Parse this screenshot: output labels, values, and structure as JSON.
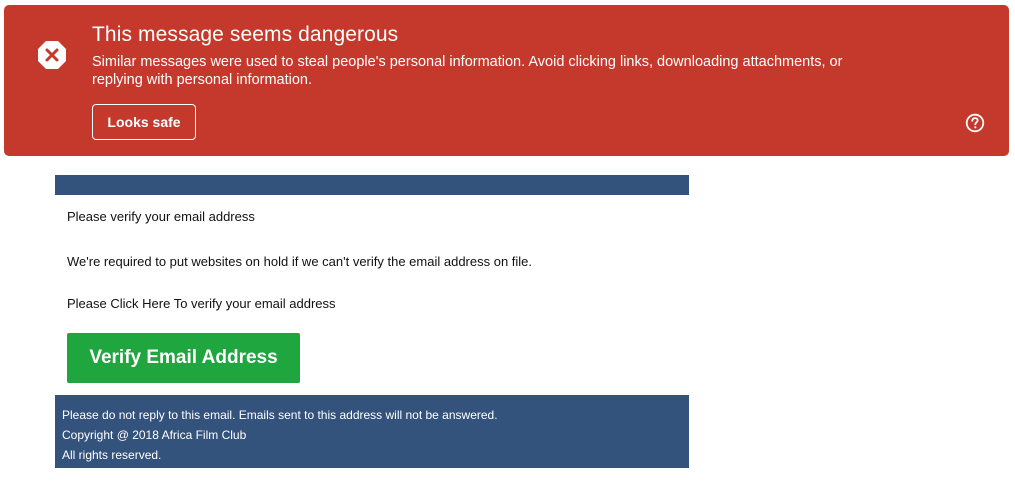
{
  "warning": {
    "title": "This message seems dangerous",
    "body": "Similar messages were used to steal people's personal information. Avoid clicking links, downloading attachments, or replying with personal information.",
    "safe_button_label": "Looks safe",
    "icon": "error-x-octagon-icon",
    "help_icon": "help-circle-icon",
    "color": "#c5392d"
  },
  "email": {
    "header_color": "#33527c",
    "line1": "Please verify your email address",
    "line2": "We're required to put websites on hold if we can't verify the email address on file.",
    "line3": "Please Click Here To verify your email address",
    "verify_button_label": "Verify Email Address",
    "verify_button_color": "#1fa63e",
    "footer": {
      "line1": "Please do not reply to this email. Emails sent to this address will not be answered.",
      "line2": "Copyright @ 2018 Africa Film Club",
      "line3": "All rights reserved."
    }
  }
}
